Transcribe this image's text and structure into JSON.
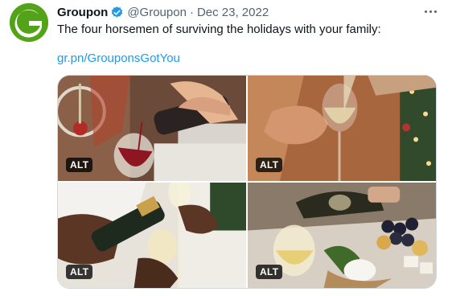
{
  "tweet": {
    "author_name": "Groupon",
    "handle": "@Groupon",
    "separator": "·",
    "date": "Dec 23, 2022",
    "text": "The four horsemen of surviving the holidays with your family:",
    "link": "gr.pn/GrouponsGotYou"
  },
  "media": {
    "alt_badge": "ALT",
    "photos": [
      {
        "subject": "red wine pour"
      },
      {
        "subject": "white wine glass held"
      },
      {
        "subject": "champagne pour"
      },
      {
        "subject": "white wine with cheese board"
      }
    ]
  },
  "colors": {
    "brand": "#53a318",
    "verified": "#1d9bf0",
    "link": "#1d9bf0",
    "secondary_text": "#536471"
  },
  "icons": {
    "avatar": "groupon-logo-icon",
    "verified": "verified-badge-icon",
    "more": "more-options-icon"
  }
}
